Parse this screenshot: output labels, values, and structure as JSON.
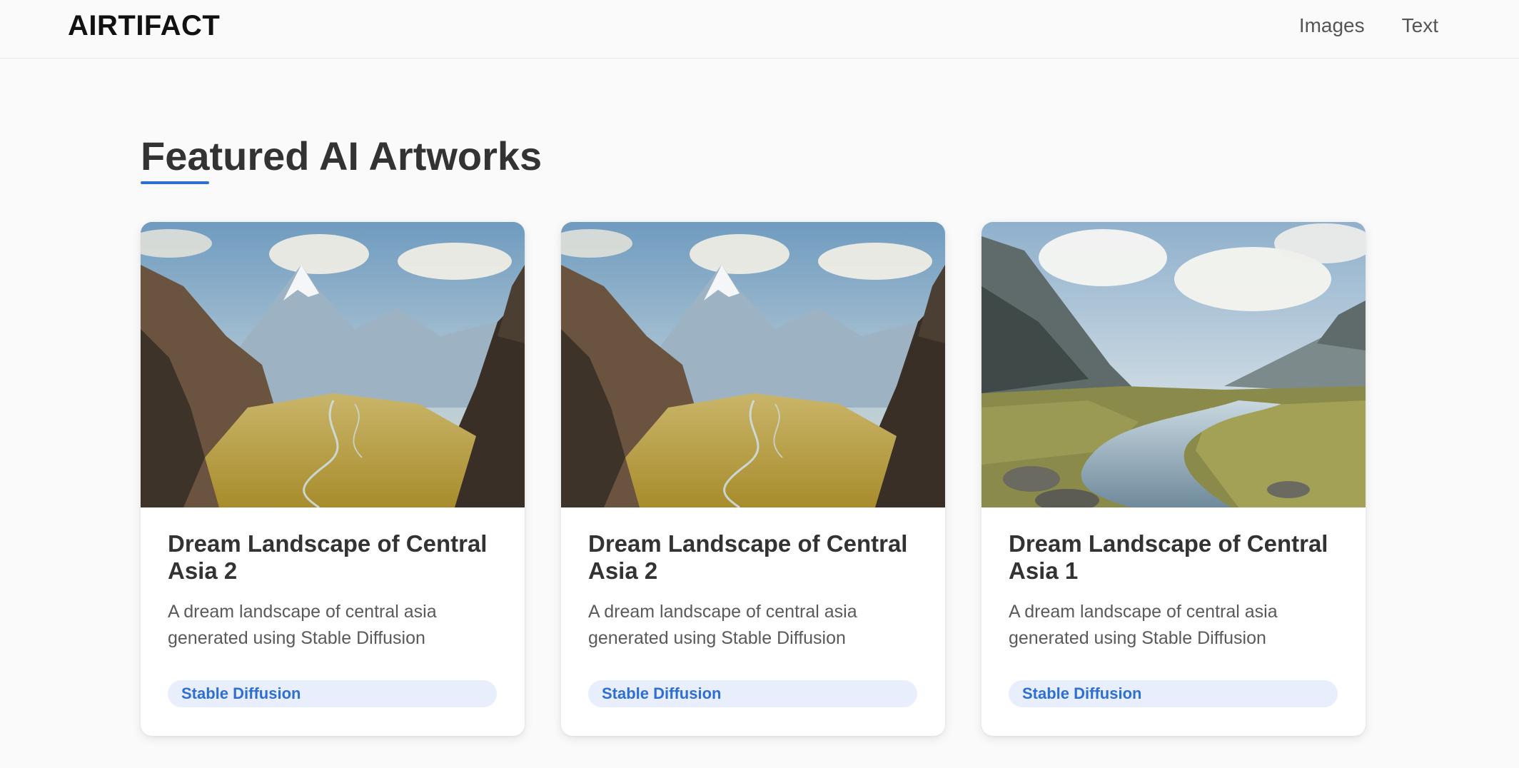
{
  "header": {
    "logo": "AIRTIFACT",
    "nav": [
      {
        "label": "Images"
      },
      {
        "label": "Text"
      }
    ]
  },
  "main": {
    "section_title": "Featured AI Artworks",
    "cards": [
      {
        "title": "Dream Landscape of Central Asia 2",
        "description": "A dream landscape of central asia generated using Stable Diffusion",
        "tag": "Stable Diffusion",
        "image": "mountain-valley-landscape"
      },
      {
        "title": "Dream Landscape of Central Asia 2",
        "description": "A dream landscape of central asia generated using Stable Diffusion",
        "tag": "Stable Diffusion",
        "image": "mountain-valley-landscape"
      },
      {
        "title": "Dream Landscape of Central Asia 1",
        "description": "A dream landscape of central asia generated using Stable Diffusion",
        "tag": "Stable Diffusion",
        "image": "river-valley-landscape"
      }
    ]
  },
  "colors": {
    "accent": "#2e6fd4",
    "tag_background": "#e8eefb",
    "page_background": "#fafafa"
  }
}
